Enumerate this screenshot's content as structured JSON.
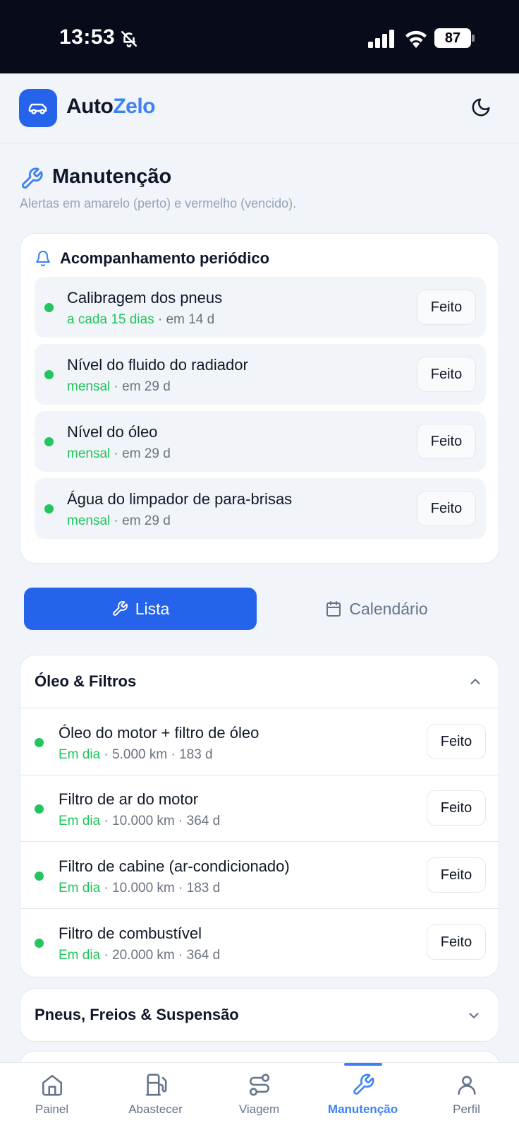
{
  "status_bar": {
    "time": "13:53",
    "battery": "87"
  },
  "app": {
    "brand_part1": "Auto",
    "brand_part2": "Zelo"
  },
  "page": {
    "title": "Manutenção",
    "subtitle": "Alertas em amarelo (perto) e vermelho (vencido)."
  },
  "periodic": {
    "title": "Acompanhamento periódico",
    "items": [
      {
        "name": "Calibragem dos pneus",
        "freq": "a cada 15 dias",
        "due": " · em 14 d",
        "button": "Feito"
      },
      {
        "name": "Nível do fluido do radiador",
        "freq": "mensal",
        "due": " · em 29 d",
        "button": "Feito"
      },
      {
        "name": "Nível do óleo",
        "freq": "mensal",
        "due": " · em 29 d",
        "button": "Feito"
      },
      {
        "name": "Água do limpador de para-brisas",
        "freq": "mensal",
        "due": " · em 29 d",
        "button": "Feito"
      }
    ]
  },
  "view_toggle": {
    "list": "Lista",
    "calendar": "Calendário"
  },
  "sections": [
    {
      "title": "Óleo & Filtros",
      "expanded": true,
      "items": [
        {
          "name": "Óleo do motor + filtro de óleo",
          "status": "Em dia",
          "detail": " · 5.000 km · 183 d",
          "button": "Feito"
        },
        {
          "name": "Filtro de ar do motor",
          "status": "Em dia",
          "detail": " · 10.000 km · 364 d",
          "button": "Feito"
        },
        {
          "name": "Filtro de cabine (ar-condicionado)",
          "status": "Em dia",
          "detail": " · 10.000 km · 183 d",
          "button": "Feito"
        },
        {
          "name": "Filtro de combustível",
          "status": "Em dia",
          "detail": " · 20.000 km · 364 d",
          "button": "Feito"
        }
      ]
    },
    {
      "title": "Pneus, Freios & Suspensão",
      "expanded": false
    }
  ],
  "nav": [
    {
      "label": "Painel",
      "active": false
    },
    {
      "label": "Abastecer",
      "active": false
    },
    {
      "label": "Viagem",
      "active": false
    },
    {
      "label": "Manutenção",
      "active": true
    },
    {
      "label": "Perfil",
      "active": false
    }
  ],
  "colors": {
    "accent": "#2563eb",
    "ok": "#22c55e",
    "muted": "#6b7280"
  }
}
